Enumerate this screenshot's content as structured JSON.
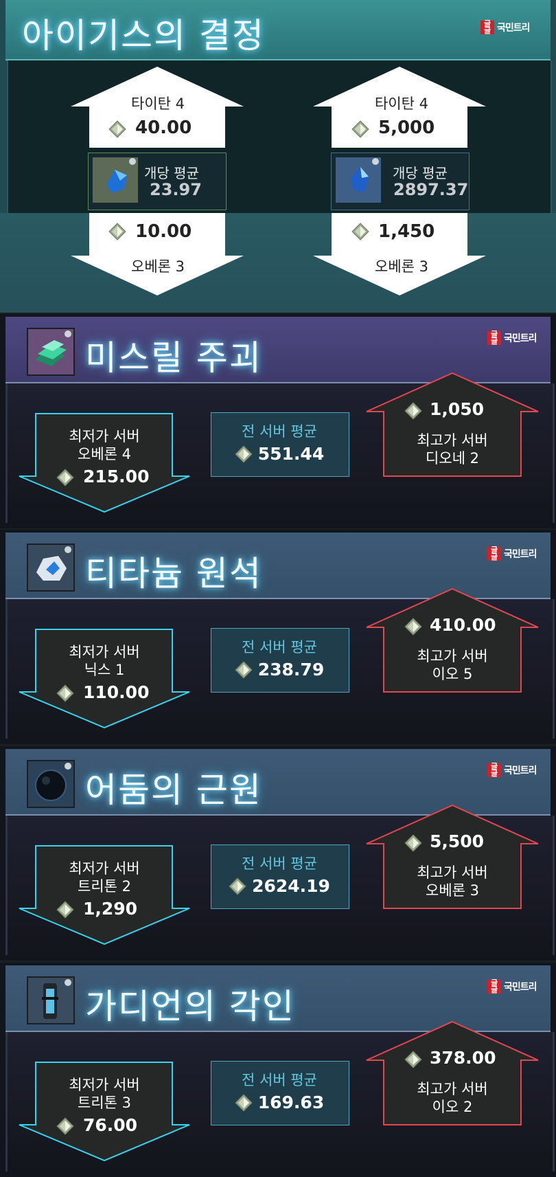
{
  "logo_text": "국민트리",
  "top": {
    "title": "아이기스의 결정",
    "left": {
      "up_server": "타이탄 4",
      "up_price": "40.00",
      "avg_label": "개당 평균",
      "avg_value": "23.97",
      "down_price": "10.00",
      "down_server": "오베론 3",
      "gem_icon": "blue-crystal-shard-icon"
    },
    "right": {
      "up_server": "타이탄 4",
      "up_price": "5,000",
      "avg_label": "개당 평균",
      "avg_value": "2897.37",
      "down_price": "1,450",
      "down_server": "오베론 3",
      "gem_icon": "blue-crystal-icon"
    }
  },
  "labels": {
    "lowest": "최저가 서버",
    "average": "전 서버 평균",
    "highest": "최고가 서버"
  },
  "items": [
    {
      "name": "미스릴 주괴",
      "icon": "mithril-ingot-icon",
      "low_server": "오베론 4",
      "low_price": "215.00",
      "avg": "551.44",
      "high_price": "1,050",
      "high_server": "디오네 2"
    },
    {
      "name": "티타늄 원석",
      "icon": "titanium-ore-icon",
      "low_server": "닉스 1",
      "low_price": "110.00",
      "avg": "238.79",
      "high_price": "410.00",
      "high_server": "이오 5"
    },
    {
      "name": "어둠의 근원",
      "icon": "dark-orb-icon",
      "low_server": "트리톤 2",
      "low_price": "1,290",
      "avg": "2624.19",
      "high_price": "5,500",
      "high_server": "오베론 3"
    },
    {
      "name": "가디언의 각인",
      "icon": "guardian-seal-vial-icon",
      "low_server": "트리톤 3",
      "low_price": "76.00",
      "avg": "169.63",
      "high_price": "378.00",
      "high_server": "이오 2"
    }
  ],
  "colors": {
    "cyan_border": "#37d3ee",
    "red_border": "#e2474f",
    "top_header": "#2d7e83",
    "section2_header": "#453f6e"
  }
}
